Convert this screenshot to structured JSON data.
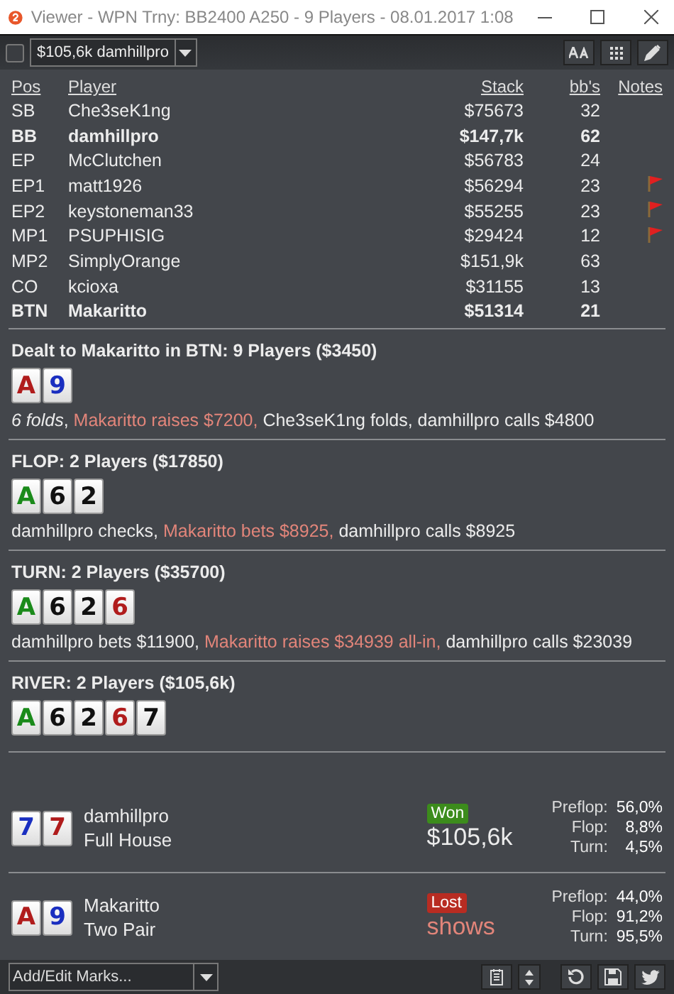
{
  "window": {
    "title": "Viewer - WPN Trny: BB2400 A250 - 9 Players - 08.01.2017 1:08"
  },
  "toolbar": {
    "checked": false,
    "hand_select": "$105,6k damhillpro"
  },
  "players": {
    "columns": [
      "Pos",
      "Player",
      "Stack",
      "bb's",
      "Notes"
    ],
    "rows": [
      {
        "pos": "SB",
        "name": "Che3seK1ng",
        "stack": "$75673",
        "bbs": "32",
        "bold": false,
        "note": false
      },
      {
        "pos": "BB",
        "name": "damhillpro",
        "stack": "$147,7k",
        "bbs": "62",
        "bold": true,
        "note": false
      },
      {
        "pos": "EP",
        "name": "McClutchen",
        "stack": "$56783",
        "bbs": "24",
        "bold": false,
        "note": false
      },
      {
        "pos": "EP1",
        "name": "matt1926",
        "stack": "$56294",
        "bbs": "23",
        "bold": false,
        "note": true
      },
      {
        "pos": "EP2",
        "name": "keystoneman33",
        "stack": "$55255",
        "bbs": "23",
        "bold": false,
        "note": true
      },
      {
        "pos": "MP1",
        "name": "PSUPHISIG",
        "stack": "$29424",
        "bbs": "12",
        "bold": false,
        "note": true
      },
      {
        "pos": "MP2",
        "name": "SimplyOrange",
        "stack": "$151,9k",
        "bbs": "63",
        "bold": false,
        "note": false
      },
      {
        "pos": "CO",
        "name": "kcioxa",
        "stack": "$31155",
        "bbs": "13",
        "bold": false,
        "note": false
      },
      {
        "pos": "BTN",
        "name": "Makaritto",
        "stack": "$51314",
        "bbs": "21",
        "bold": true,
        "note": false
      }
    ]
  },
  "streets": [
    {
      "heading": "Dealt to Makaritto in BTN: 9 Players ($3450)",
      "cards": [
        {
          "rank": "A",
          "color": "#b01c1c"
        },
        {
          "rank": "9",
          "color": "#1a2fc0"
        }
      ],
      "actions": [
        {
          "text": "6 folds",
          "kind": "italic"
        },
        {
          "text": ", ",
          "kind": "plain"
        },
        {
          "text": "Makaritto raises $7200,",
          "kind": "hero"
        },
        {
          "text": " Che3seK1ng folds, damhillpro calls $4800",
          "kind": "plain"
        }
      ]
    },
    {
      "heading": "FLOP: 2 Players ($17850)",
      "cards": [
        {
          "rank": "A",
          "color": "#1a8a1a"
        },
        {
          "rank": "6",
          "color": "#111111"
        },
        {
          "rank": "2",
          "color": "#111111"
        }
      ],
      "actions": [
        {
          "text": "damhillpro checks, ",
          "kind": "plain"
        },
        {
          "text": "Makaritto bets $8925,",
          "kind": "hero"
        },
        {
          "text": " damhillpro calls $8925",
          "kind": "plain"
        }
      ]
    },
    {
      "heading": "TURN: 2 Players ($35700)",
      "cards": [
        {
          "rank": "A",
          "color": "#1a8a1a"
        },
        {
          "rank": "6",
          "color": "#111111"
        },
        {
          "rank": "2",
          "color": "#111111"
        },
        {
          "rank": "6",
          "color": "#b01c1c"
        }
      ],
      "actions": [
        {
          "text": "damhillpro bets $11900, ",
          "kind": "plain"
        },
        {
          "text": "Makaritto raises $34939 all-in,",
          "kind": "hero"
        },
        {
          "text": " damhillpro calls $23039",
          "kind": "plain"
        }
      ]
    },
    {
      "heading": "RIVER: 2 Players ($105,6k)",
      "cards": [
        {
          "rank": "A",
          "color": "#1a8a1a"
        },
        {
          "rank": "6",
          "color": "#111111"
        },
        {
          "rank": "2",
          "color": "#111111"
        },
        {
          "rank": "6",
          "color": "#b01c1c"
        },
        {
          "rank": "7",
          "color": "#111111"
        }
      ]
    }
  ],
  "showdown": [
    {
      "cards": [
        {
          "rank": "7",
          "color": "#1a2fc0"
        },
        {
          "rank": "7",
          "color": "#b01c1c"
        }
      ],
      "name": "damhillpro",
      "hand": "Full House",
      "result": "Won",
      "kind": "won",
      "amount": "$105,6k",
      "equity": [
        {
          "label": "Preflop:",
          "value": "56,0%"
        },
        {
          "label": "Flop:",
          "value": "8,8%"
        },
        {
          "label": "Turn:",
          "value": "4,5%"
        }
      ]
    },
    {
      "cards": [
        {
          "rank": "A",
          "color": "#b01c1c"
        },
        {
          "rank": "9",
          "color": "#1a2fc0"
        }
      ],
      "name": "Makaritto",
      "hand": "Two Pair",
      "result": "Lost",
      "kind": "lost",
      "amount": "shows",
      "equity": [
        {
          "label": "Preflop:",
          "value": "44,0%"
        },
        {
          "label": "Flop:",
          "value": "91,2%"
        },
        {
          "label": "Turn:",
          "value": "95,5%"
        }
      ]
    }
  ],
  "bottom_bar": {
    "marks_placeholder": "Add/Edit Marks..."
  }
}
